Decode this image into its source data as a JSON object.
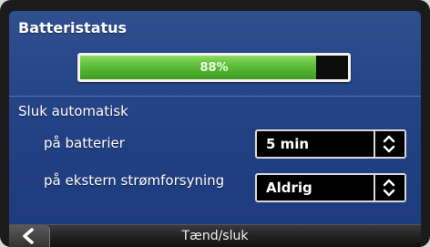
{
  "battery": {
    "title": "Batteristatus",
    "level_percent": 88,
    "level_label": "88%",
    "fill_color": "#5cbb38"
  },
  "auto_off": {
    "title": "Sluk automatisk",
    "on_battery": {
      "label": "på batterier",
      "value": "5 min"
    },
    "on_external": {
      "label": "på ekstern strømforsyning",
      "value": "Aldrig"
    }
  },
  "bottom_bar": {
    "title": "Tænd/sluk",
    "back_icon": "chevron-left-icon"
  },
  "colors": {
    "screen_bg": "#234285",
    "select_bg": "#000000",
    "text": "#ffffff"
  }
}
